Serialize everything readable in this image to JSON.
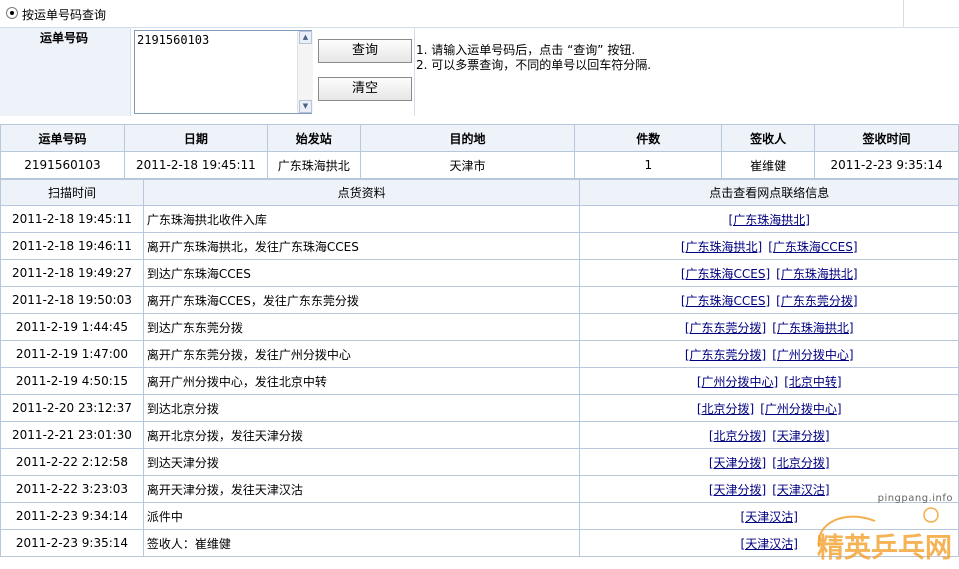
{
  "search_mode": {
    "label": "按运单号码查询",
    "selected": true
  },
  "query": {
    "label": "运单号码",
    "value": "2191560103",
    "query_button": "查询",
    "clear_button": "清空",
    "hint_1": "1. 请输入运单号码后，点击 “查询” 按钮.",
    "hint_2": "2. 可以多票查询，不同的单号以回车符分隔."
  },
  "summary": {
    "headers": [
      "运单号码",
      "日期",
      "始发站",
      "目的地",
      "件数",
      "签收人",
      "签收时间"
    ],
    "row": [
      "2191560103",
      "2011-2-18 19:45:11",
      "广东珠海拱北",
      "天津市",
      "1",
      "崔维健",
      "2011-2-23 9:35:14"
    ]
  },
  "tracking": {
    "headers": [
      "扫描时间",
      "点货资料",
      "点击查看网点联络信息"
    ],
    "rows": [
      {
        "time": "2011-2-18 19:45:11",
        "status": "广东珠海拱北收件入库",
        "links": [
          "[广东珠海拱北]"
        ]
      },
      {
        "time": "2011-2-18 19:46:11",
        "status": "离开广东珠海拱北，发往广东珠海CCES",
        "links": [
          "[广东珠海拱北]",
          "[广东珠海CCES]"
        ]
      },
      {
        "time": "2011-2-18 19:49:27",
        "status": "到达广东珠海CCES",
        "links": [
          "[广东珠海CCES]",
          "[广东珠海拱北]"
        ]
      },
      {
        "time": "2011-2-18 19:50:03",
        "status": "离开广东珠海CCES，发往广东东莞分拨",
        "links": [
          "[广东珠海CCES]",
          "[广东东莞分拨]"
        ]
      },
      {
        "time": "2011-2-19 1:44:45",
        "status": "到达广东东莞分拨",
        "links": [
          "[广东东莞分拨]",
          "[广东珠海拱北]"
        ]
      },
      {
        "time": "2011-2-19 1:47:00",
        "status": "离开广东东莞分拨，发往广州分拨中心",
        "links": [
          "[广东东莞分拨]",
          "[广州分拨中心]"
        ]
      },
      {
        "time": "2011-2-19 4:50:15",
        "status": "离开广州分拨中心，发往北京中转",
        "links": [
          "[广州分拨中心]",
          "[北京中转]"
        ]
      },
      {
        "time": "2011-2-20 23:12:37",
        "status": "到达北京分拨",
        "links": [
          "[北京分拨]",
          "[广州分拨中心]"
        ]
      },
      {
        "time": "2011-2-21 23:01:30",
        "status": "离开北京分拨，发往天津分拨",
        "links": [
          "[北京分拨]",
          "[天津分拨]"
        ]
      },
      {
        "time": "2011-2-22 2:12:58",
        "status": "到达天津分拨",
        "links": [
          "[天津分拨]",
          "[北京分拨]"
        ]
      },
      {
        "time": "2011-2-22 3:23:03",
        "status": "离开天津分拨，发往天津汉沽",
        "links": [
          "[天津分拨]",
          "[天津汉沽]"
        ]
      },
      {
        "time": "2011-2-23 9:34:14",
        "status": "派件中",
        "links": [
          "[天津汉沽]"
        ]
      },
      {
        "time": "2011-2-23 9:35:14",
        "status": "签收人：崔维健",
        "links": [
          "[天津汉沽]"
        ]
      }
    ]
  },
  "watermark": {
    "url": "pingpang.info",
    "text": "精英乒乓网"
  },
  "colors": {
    "header_bg": "#eef3fa",
    "border": "#b8c8dc",
    "link": "#000080",
    "watermark_orange": "#f39a1e"
  }
}
